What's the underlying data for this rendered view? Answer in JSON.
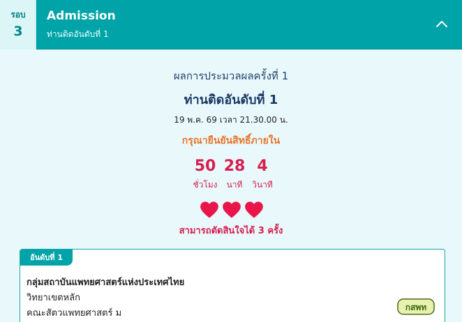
{
  "header": {
    "round_label": "รอบ",
    "round_number": "3",
    "title": "Admission",
    "subtitle": "ท่านติดอันดับที่ 1"
  },
  "result": {
    "heading": "ผลการประมวลผลครั้งที่ 1",
    "title": "ท่านติดอันดับที่ 1",
    "date": "19 พ.ค. 69 เวลา 21.30.00 น.",
    "confirm_label": "กรุณายืนยันสิทธิ์ภายใน"
  },
  "countdown": {
    "hours": "50",
    "hours_unit": "ชั่วโมง",
    "minutes": "28",
    "minutes_unit": "นาที",
    "seconds": "4",
    "seconds_unit": "วินาที"
  },
  "decisions": {
    "remaining": 3,
    "text": "สามารถตัดสินใจได้ 3 ครั้ง",
    "heart_color": "#e8164a"
  },
  "card": {
    "tab_label": "อันดับที่ 1",
    "group": "กลุ่มสถาบันแพทยศาสตร์แห่งประเทศไทย",
    "campus": "วิทยาเขตหลัก",
    "faculty": "คณะสัตวแพทยศาสตร์ ม",
    "logo_text": "กสพท"
  },
  "colors": {
    "brand": "#00a3a7",
    "accent": "#d61e4f",
    "warning": "#e8742a"
  }
}
